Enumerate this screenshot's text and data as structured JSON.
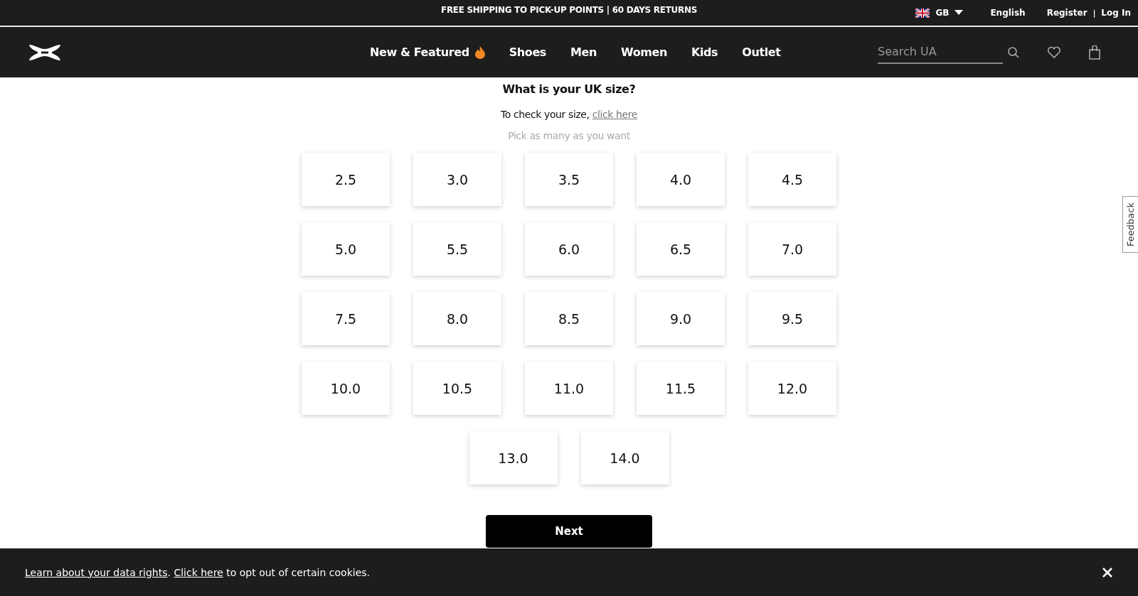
{
  "promo_bar": {
    "text": "FREE SHIPPING TO PICK-UP POINTS | 60 DAYS RETURNS",
    "country": "GB",
    "language": "English",
    "register": "Register",
    "separator": "|",
    "login": "Log In"
  },
  "nav": {
    "items": [
      {
        "label": "New & Featured",
        "hot": true
      },
      {
        "label": "Shoes",
        "hot": false
      },
      {
        "label": "Men",
        "hot": false
      },
      {
        "label": "Women",
        "hot": false
      },
      {
        "label": "Kids",
        "hot": false
      },
      {
        "label": "Outlet",
        "hot": false
      }
    ],
    "search": {
      "placeholder": "Search UA"
    }
  },
  "question": {
    "title": "What is your UK size?",
    "hint_prefix": "To check your size,",
    "hint_link": "click here",
    "note": "Pick as many as you want"
  },
  "sizes": [
    "2.5",
    "3.0",
    "3.5",
    "4.0",
    "4.5",
    "5.0",
    "5.5",
    "6.0",
    "6.5",
    "7.0",
    "7.5",
    "8.0",
    "8.5",
    "9.0",
    "9.5",
    "10.0",
    "10.5",
    "11.0",
    "11.5",
    "12.0",
    "13.0",
    "14.0"
  ],
  "next_button": "Next",
  "feedback_tab": "Feedback",
  "cookie_bar": {
    "link1": "Learn about your data rights",
    "sep": ".",
    "link2": "Click here",
    "rest": "to opt out of certain cookies."
  }
}
